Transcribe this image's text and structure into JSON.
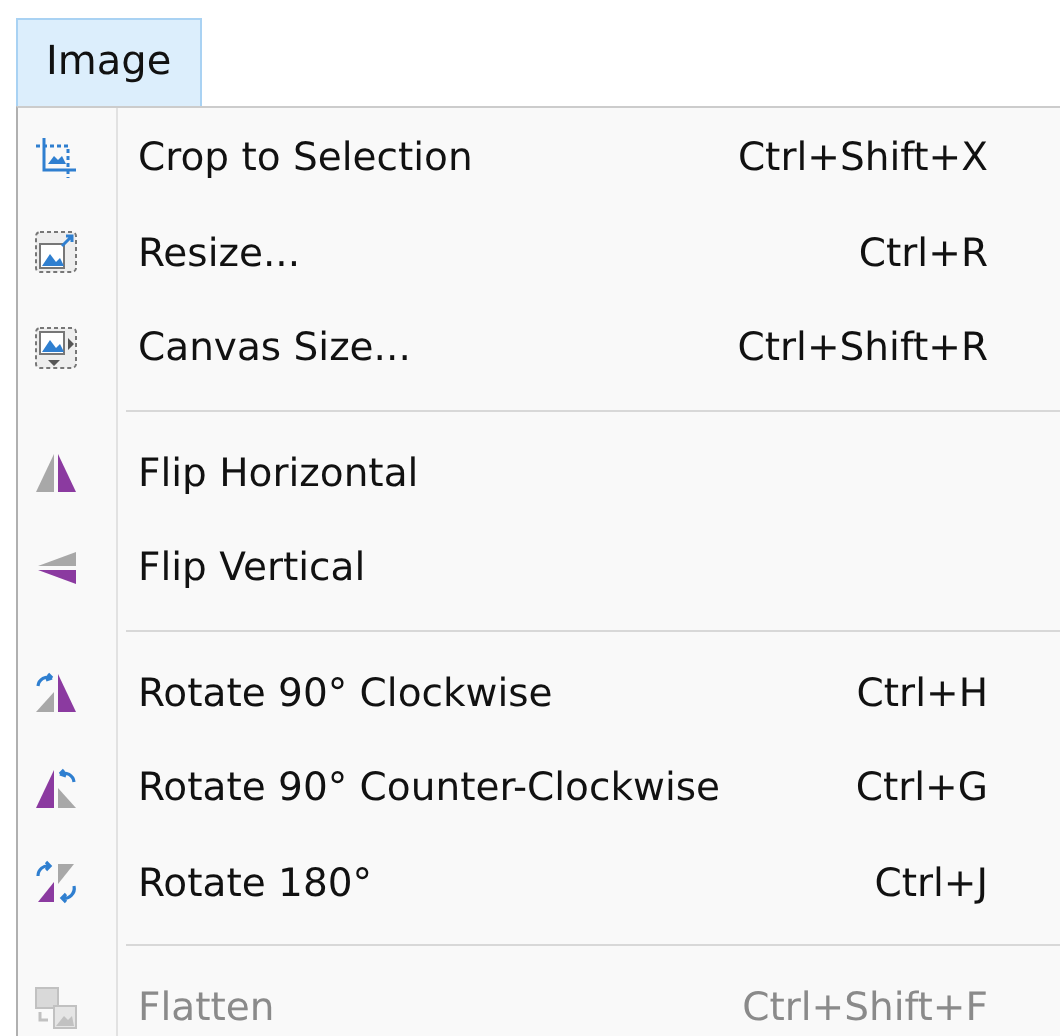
{
  "menu_bar": {
    "title": "Image",
    "selected": true
  },
  "menu_groups": [
    {
      "items": [
        {
          "label": "Crop to Selection",
          "shortcut": "Ctrl+Shift+X",
          "disabled": false
        },
        {
          "label": "Resize...",
          "shortcut": "Ctrl+R",
          "disabled": false
        },
        {
          "label": "Canvas Size...",
          "shortcut": "Ctrl+Shift+R",
          "disabled": false
        }
      ]
    },
    {
      "items": [
        {
          "label": "Flip Horizontal",
          "disabled": false
        },
        {
          "label": "Flip Vertical",
          "disabled": false
        }
      ]
    },
    {
      "items": [
        {
          "label": "Rotate 90° Clockwise",
          "shortcut": "Ctrl+H",
          "disabled": false
        },
        {
          "label": "Rotate 90° Counter-Clockwise",
          "shortcut": "Ctrl+G",
          "disabled": false
        },
        {
          "label": "Rotate 180°",
          "shortcut": "Ctrl+J",
          "disabled": false
        }
      ]
    },
    {
      "items": [
        {
          "label": "Flatten",
          "shortcut": "Ctrl+Shift+F",
          "disabled": true
        }
      ]
    }
  ]
}
